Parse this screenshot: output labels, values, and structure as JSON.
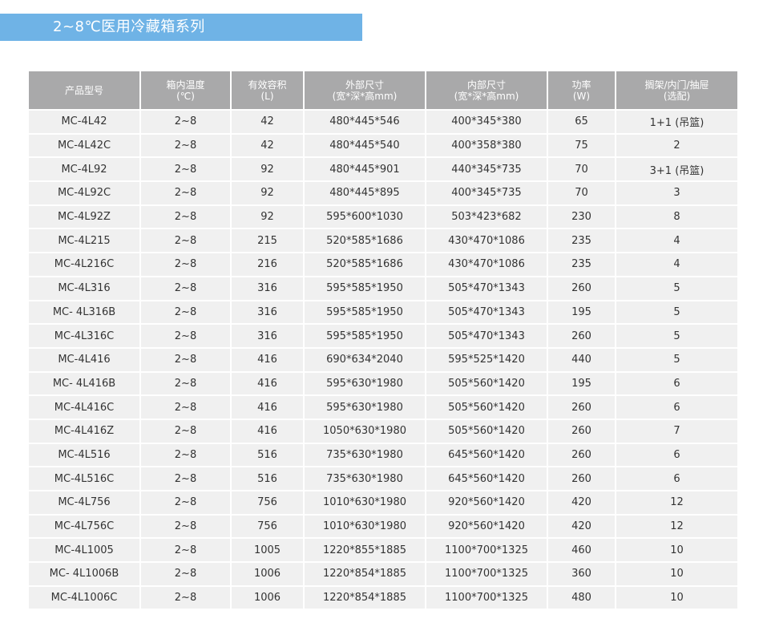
{
  "title": "2~8℃医用冷藏箱系列",
  "headers": [
    {
      "main": "产品型号",
      "sub": ""
    },
    {
      "main": "箱内温度",
      "sub": "(℃)"
    },
    {
      "main": "有效容积",
      "sub": "(L)"
    },
    {
      "main": "外部尺寸",
      "sub": "(宽*深*高mm)"
    },
    {
      "main": "内部尺寸",
      "sub": "(宽*深*高mm)"
    },
    {
      "main": "功率",
      "sub": "(W)"
    },
    {
      "main": "搁架/内门/抽屉",
      "sub": "(选配)"
    }
  ],
  "rows": [
    [
      "MC-4L42",
      "2~8",
      "42",
      "480*445*546",
      "400*345*380",
      "65",
      "1+1 (吊篮)"
    ],
    [
      "MC-4L42C",
      "2~8",
      "42",
      "480*445*540",
      "400*358*380",
      "75",
      "2"
    ],
    [
      "MC-4L92",
      "2~8",
      "92",
      "480*445*901",
      "440*345*735",
      "70",
      "3+1 (吊篮)"
    ],
    [
      "MC-4L92C",
      "2~8",
      "92",
      "480*445*895",
      "400*345*735",
      "70",
      "3"
    ],
    [
      "MC-4L92Z",
      "2~8",
      "92",
      "595*600*1030",
      "503*423*682",
      "230",
      "8"
    ],
    [
      "MC-4L215",
      "2~8",
      "215",
      "520*585*1686",
      "430*470*1086",
      "235",
      "4"
    ],
    [
      "MC-4L216C",
      "2~8",
      "216",
      "520*585*1686",
      "430*470*1086",
      "235",
      "4"
    ],
    [
      "MC-4L316",
      "2~8",
      "316",
      "595*585*1950",
      "505*470*1343",
      "260",
      "5"
    ],
    [
      "MC- 4L316B",
      "2~8",
      "316",
      "595*585*1950",
      "505*470*1343",
      "195",
      "5"
    ],
    [
      "MC-4L316C",
      "2~8",
      "316",
      "595*585*1950",
      "505*470*1343",
      "260",
      "5"
    ],
    [
      "MC-4L416",
      "2~8",
      "416",
      "690*634*2040",
      "595*525*1420",
      "440",
      "5"
    ],
    [
      "MC- 4L416B",
      "2~8",
      "416",
      "595*630*1980",
      "505*560*1420",
      "195",
      "6"
    ],
    [
      "MC-4L416C",
      "2~8",
      "416",
      "595*630*1980",
      "505*560*1420",
      "260",
      "6"
    ],
    [
      "MC-4L416Z",
      "2~8",
      "416",
      "1050*630*1980",
      "505*560*1420",
      "260",
      "7"
    ],
    [
      "MC-4L516",
      "2~8",
      "516",
      "735*630*1980",
      "645*560*1420",
      "260",
      "6"
    ],
    [
      "MC-4L516C",
      "2~8",
      "516",
      "735*630*1980",
      "645*560*1420",
      "260",
      "6"
    ],
    [
      "MC-4L756",
      "2~8",
      "756",
      "1010*630*1980",
      "920*560*1420",
      "420",
      "12"
    ],
    [
      "MC-4L756C",
      "2~8",
      "756",
      "1010*630*1980",
      "920*560*1420",
      "420",
      "12"
    ],
    [
      "MC-4L1005",
      "2~8",
      "1005",
      "1220*855*1885",
      "1100*700*1325",
      "460",
      "10"
    ],
    [
      "MC- 4L1006B",
      "2~8",
      "1006",
      "1220*854*1885",
      "1100*700*1325",
      "360",
      "10"
    ],
    [
      "MC-4L1006C",
      "2~8",
      "1006",
      "1220*854*1885",
      "1100*700*1325",
      "480",
      "10"
    ]
  ]
}
